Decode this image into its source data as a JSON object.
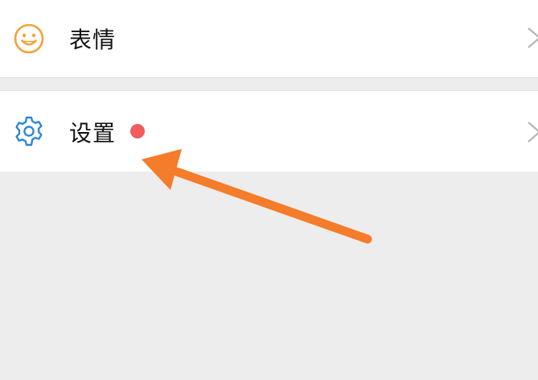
{
  "menu": {
    "items": [
      {
        "label": "表情",
        "icon": "smiley-icon",
        "icon_color": "#f0a33b"
      },
      {
        "label": "设置",
        "icon": "gear-icon",
        "icon_color": "#2f86d6",
        "has_badge": true,
        "badge_color": "#f25c5c"
      }
    ]
  },
  "annotation": {
    "type": "arrow",
    "color": "#f47c2a"
  },
  "colors": {
    "background": "#ededed",
    "row_background": "#ffffff"
  }
}
